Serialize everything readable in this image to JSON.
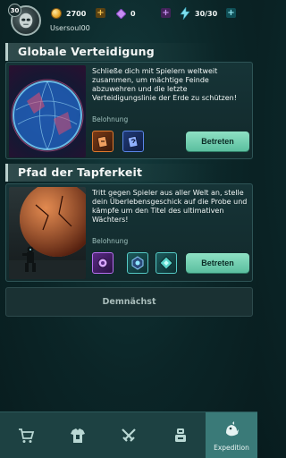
{
  "player": {
    "level": "30",
    "username": "Usersoul00"
  },
  "resources": {
    "coins": "2700",
    "gems": "0",
    "energy": "30/30"
  },
  "sections": [
    {
      "title": "Globale Verteidigung",
      "description": "Schließe dich mit Spielern weltweit zusammen, um mächtige Feinde abzuwehren und die letzte Verteidigungslinie der Erde zu schützen!",
      "reward_label": "Belohnung",
      "button_label": "Betreten",
      "rewards": [
        "orange-card-reward-icon",
        "blue-card-reward-icon"
      ]
    },
    {
      "title": "Pfad der Tapferkeit",
      "description": "Tritt gegen Spieler aus aller Welt an, stelle dein Überlebensgeschick auf die Probe und kämpfe um den Titel des ultimativen Wächters!",
      "reward_label": "Belohnung",
      "button_label": "Betreten",
      "rewards": [
        "purple-orb-reward-icon",
        "blue-core-reward-icon",
        "teal-gem-reward-icon"
      ]
    }
  ],
  "coming_soon": "Demnächst",
  "bottom_nav": {
    "items": [
      {
        "icon": "shop-cart-icon"
      },
      {
        "icon": "armor-icon"
      },
      {
        "icon": "crossed-swords-icon"
      },
      {
        "icon": "robot-icon"
      },
      {
        "icon": "expedition-icon",
        "label": "Expedition",
        "active": true
      }
    ]
  },
  "colors": {
    "accent_button": "#5bbf9f",
    "background": "#0b2527",
    "nav_active": "#3a7a78"
  }
}
